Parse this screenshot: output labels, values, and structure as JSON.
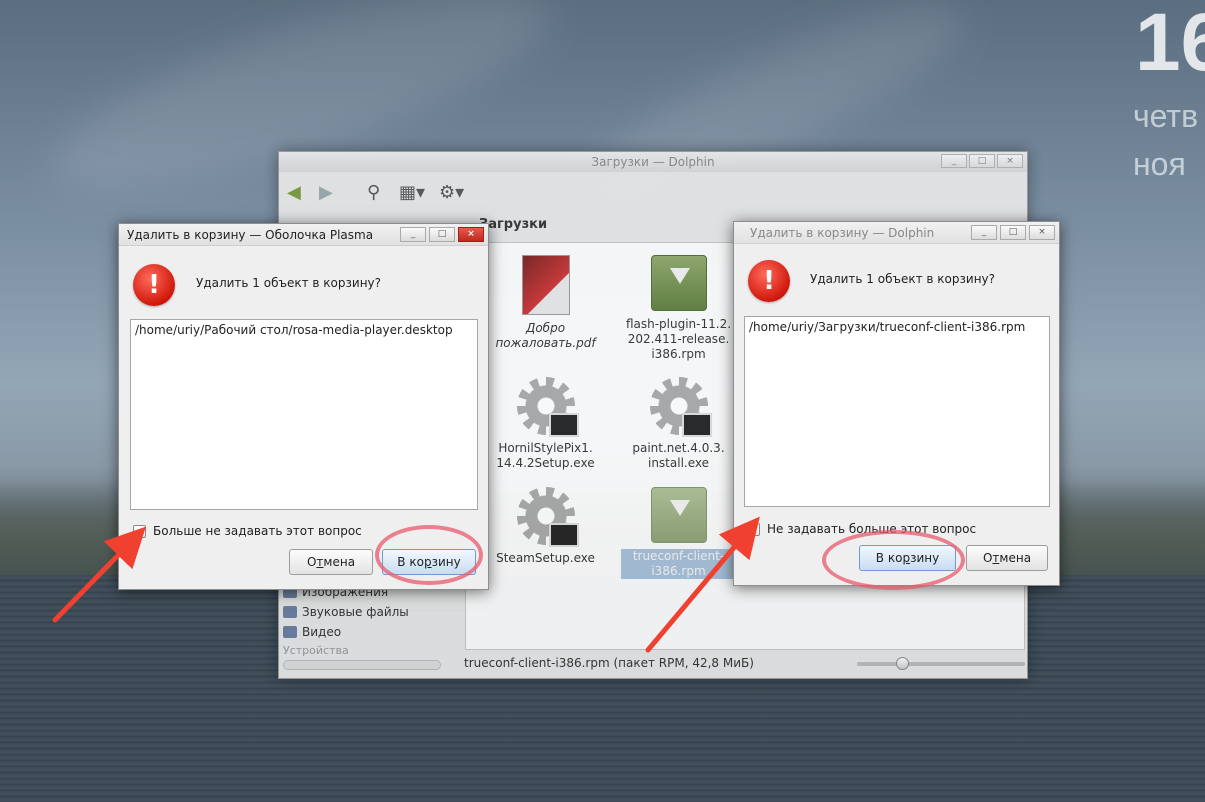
{
  "desktop": {
    "clock_big": "16",
    "clock_line1": "четв",
    "clock_line2": "ноя"
  },
  "dolphin": {
    "title": "Загрузки — Dolphin",
    "breadcrumb": "Загрузки",
    "files": [
      {
        "name": "Добро пожаловать.pdf",
        "line1": "Добро",
        "line2": "пожаловать.pdf",
        "type": "pdf"
      },
      {
        "name": "flash-plugin-11.2.202.411-release.i386.rpm",
        "line1": "flash-plugin-11.2.",
        "line2": "202.411-release.",
        "line3": "i386.rpm",
        "type": "rpm"
      },
      {
        "name": "HornilStylePix1.14.4.2Setup.exe",
        "line1": "HornilStylePix1.",
        "line2": "14.4.2Setup.exe",
        "type": "exe"
      },
      {
        "name": "paint.net.4.0.3.install.exe",
        "line1": "paint.net.4.0.3.",
        "line2": "install.exe",
        "type": "exe"
      },
      {
        "name": "SteamSetup.exe",
        "line1": "SteamSetup.exe",
        "type": "exe"
      },
      {
        "name": "trueconf-client-i386.rpm",
        "line1": "trueconf-client-",
        "line2": "i386.rpm",
        "type": "rpm",
        "selected": true
      }
    ],
    "sidebar": [
      {
        "label": "Изображения"
      },
      {
        "label": "Звуковые файлы"
      },
      {
        "label": "Видео"
      }
    ],
    "sidebar_section": "Устройства",
    "status": "trueconf-client-i386.rpm (пакет RPM, 42,8 МиБ)"
  },
  "plasma_dialog": {
    "title": "Удалить в корзину — Оболочка Plasma",
    "question": "Удалить 1 объект в корзину?",
    "path": "/home/uriy/Рабочий стол/rosa-media-player.desktop",
    "checkbox": "Больше не задавать этот вопрос",
    "cancel_pre": "О",
    "cancel_u": "т",
    "cancel_post": "мена",
    "confirm_pre": "В ко",
    "confirm_u": "р",
    "confirm_post": "зину"
  },
  "dolphin_dialog": {
    "title": "Удалить в корзину — Dolphin",
    "question": "Удалить 1 объект в корзину?",
    "path": "/home/uriy/Загрузки/trueconf-client-i386.rpm",
    "checkbox": "Не задавать больше этот вопрос",
    "confirm_pre": "В ко",
    "confirm_u": "р",
    "confirm_post": "зину",
    "cancel_pre": "О",
    "cancel_u": "т",
    "cancel_post": "мена"
  },
  "colors": {
    "annotation_arrow": "#f04030",
    "annotation_circle": "#e85a6e",
    "warning": "#d0180c"
  }
}
